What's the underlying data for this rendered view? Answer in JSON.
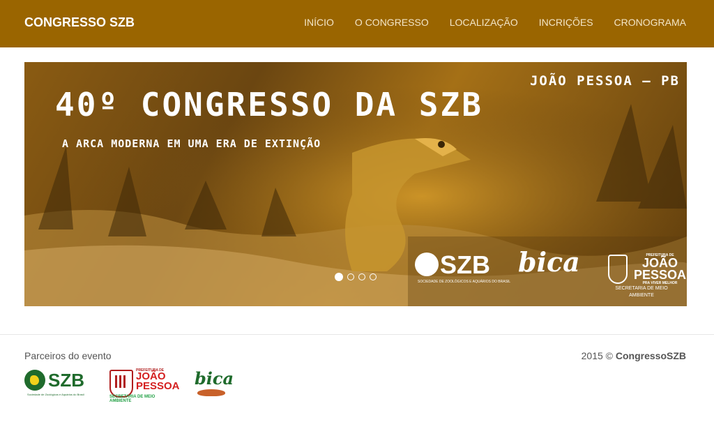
{
  "navbar": {
    "brand": "CONGRESSO SZB",
    "links": [
      "INÍCIO",
      "O CONGRESSO",
      "LOCALIZAÇÃO",
      "INCRIÇÕES",
      "CRONOGRAMA"
    ]
  },
  "carousel": {
    "title": "40º CONGRESSO DA SZB",
    "subtitle": "A ARCA MODERNA EM UMA ERA DE EXTINÇÃO",
    "city": "JOÃO PESSOA – PB",
    "logos": {
      "szb": "SZB",
      "szb_caption": "SOCIEDADE DE ZOOLÓGICOS E AQUÁRIOS DO BRASIL",
      "bica": "bica",
      "pref_top": "PREFEITURA DE",
      "pref_name_1": "JOÃO",
      "pref_name_2": "PESSOA",
      "pref_tagline": "PRA VIVER MELHOR",
      "pref_secretaria": "SECRETARIA DE MEIO AMBIENTE"
    },
    "slide_count": 4,
    "active_index": 0
  },
  "footer": {
    "partners_label": "Parceiros do evento",
    "copyright_prefix": "2015 ©",
    "copyright_name": "CongressoSZB",
    "partners": {
      "szb": "SZB",
      "szb_caption": "Sociedade de Zoológicos e Aquários do Brasil",
      "pref_top": "PREFEITURA DE",
      "pref_name_1": "JOÃO",
      "pref_name_2": "PESSOA",
      "pref_secretaria": "SECRETARIA DE MEIO AMBIENTE",
      "bica": "bica"
    }
  },
  "colors": {
    "navbar": "#9a6500",
    "nav_text": "#f3e6c8",
    "footer_text": "#555555",
    "szb_green": "#1f6b2c",
    "pref_red": "#d42020"
  }
}
